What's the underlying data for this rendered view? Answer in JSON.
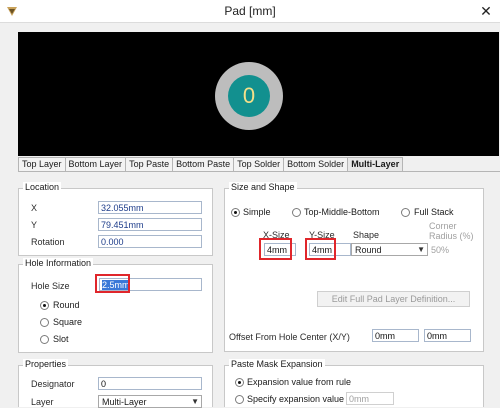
{
  "window": {
    "title": "Pad [mm]",
    "close_glyph": "✕",
    "app_icon": "altium-icon"
  },
  "preview": {
    "pad_label": "0",
    "colors": {
      "background": "#000000",
      "ring": "#bdbdbd",
      "pad": "#12908f",
      "label": "#f4e08a"
    }
  },
  "tabs": [
    "Top Layer",
    "Bottom Layer",
    "Top Paste",
    "Bottom Paste",
    "Top Solder",
    "Bottom Solder",
    "Multi-Layer"
  ],
  "active_tab": "Multi-Layer",
  "location": {
    "title": "Location",
    "x_label": "X",
    "x_value": "32.055mm",
    "y_label": "Y",
    "y_value": "79.451mm",
    "rotation_label": "Rotation",
    "rotation_value": "0.000"
  },
  "hole": {
    "title": "Hole Information",
    "size_label": "Hole Size",
    "size_value": "2.5mm",
    "options": [
      "Round",
      "Square",
      "Slot"
    ],
    "selected": "Round"
  },
  "properties": {
    "title": "Properties",
    "designator_label": "Designator",
    "designator_value": "0",
    "layer_label": "Layer",
    "layer_value": "Multi-Layer"
  },
  "size_shape": {
    "title": "Size and Shape",
    "modes": [
      "Simple",
      "Top-Middle-Bottom",
      "Full Stack"
    ],
    "selected_mode": "Simple",
    "xsize_header": "X-Size",
    "ysize_header": "Y-Size",
    "shape_header": "Shape",
    "corner_header_1": "Corner",
    "corner_header_2": "Radius (%)",
    "xsize_value": "4mm",
    "ysize_value": "4mm",
    "shape_value": "Round",
    "corner_value": "50%",
    "full_pad_button": "Edit Full Pad Layer Definition...",
    "offset_label": "Offset From Hole Center (X/Y)",
    "offset_x": "0mm",
    "offset_y": "0mm"
  },
  "paste_mask": {
    "title": "Paste Mask Expansion",
    "options": [
      "Expansion value from rule",
      "Specify expansion value"
    ],
    "selected": "Expansion value from rule",
    "specify_value": "0mm"
  },
  "highlight_color": "#e0262b"
}
